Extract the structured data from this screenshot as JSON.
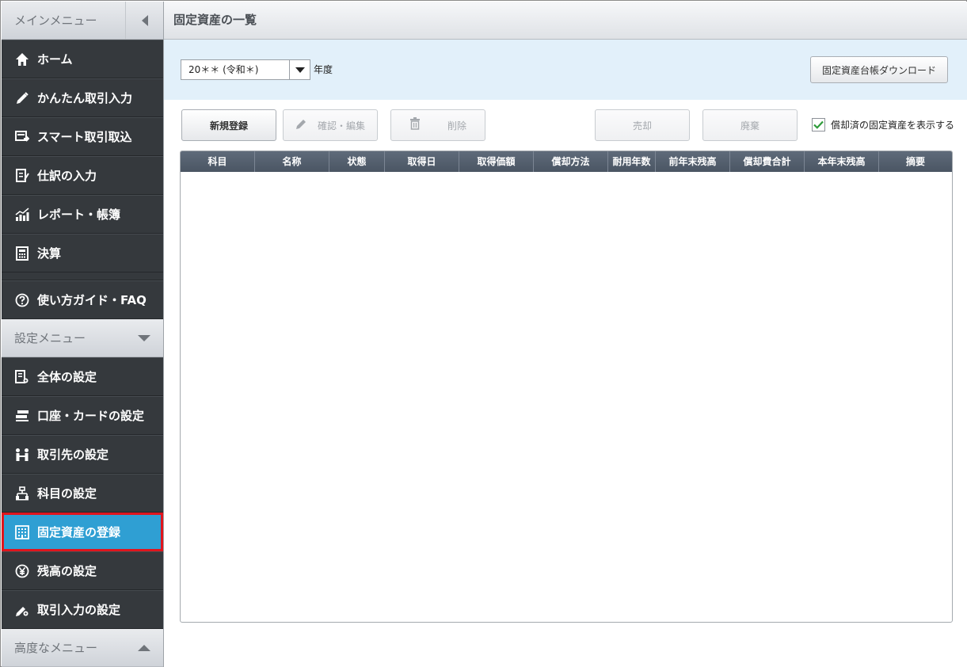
{
  "sidebar": {
    "main_menu_label": "メインメニュー",
    "main_items": [
      {
        "label": "ホーム",
        "icon": "home-icon"
      },
      {
        "label": "かんたん取引入力",
        "icon": "pencil-icon"
      },
      {
        "label": "スマート取引取込",
        "icon": "import-icon"
      },
      {
        "label": "仕訳の入力",
        "icon": "journal-icon"
      },
      {
        "label": "レポート・帳簿",
        "icon": "report-icon"
      },
      {
        "label": "決算",
        "icon": "calculator-icon"
      }
    ],
    "guide_item": {
      "label": "使い方ガイド・FAQ",
      "icon": "help-icon"
    },
    "settings_menu_label": "設定メニュー",
    "settings_items": [
      {
        "label": "全体の設定",
        "icon": "settings-doc-icon"
      },
      {
        "label": "口座・カードの設定",
        "icon": "card-icon"
      },
      {
        "label": "取引先の設定",
        "icon": "partner-icon"
      },
      {
        "label": "科目の設定",
        "icon": "account-tree-icon"
      },
      {
        "label": "固定資産の登録",
        "icon": "building-icon",
        "active": true
      },
      {
        "label": "残高の設定",
        "icon": "yen-icon"
      },
      {
        "label": "取引入力の設定",
        "icon": "input-settings-icon"
      }
    ],
    "advanced_menu_label": "高度なメニュー"
  },
  "main": {
    "title": "固定資産の一覧",
    "year_select_value": "20＊＊ (令和＊)",
    "year_suffix": "年度",
    "download_button": "固定資産台帳ダウンロード",
    "buttons": {
      "new": "新規登録",
      "edit": "確認・編集",
      "delete": "削除",
      "sell": "売却",
      "dispose": "廃棄"
    },
    "show_depreciated_label": "償却済の固定資産を表示する",
    "show_depreciated_checked": true,
    "table_columns": [
      "科目",
      "名称",
      "状態",
      "取得日",
      "取得価額",
      "償却方法",
      "耐用年数",
      "前年末残高",
      "償却費合計",
      "本年末残高",
      "摘要"
    ]
  },
  "colors": {
    "sidebar_bg": "#35393d",
    "active_item": "#2f9fd3",
    "highlight_border": "#e0151d",
    "filter_bar_bg": "#e2f0fa",
    "table_header": "#4f5a68"
  }
}
